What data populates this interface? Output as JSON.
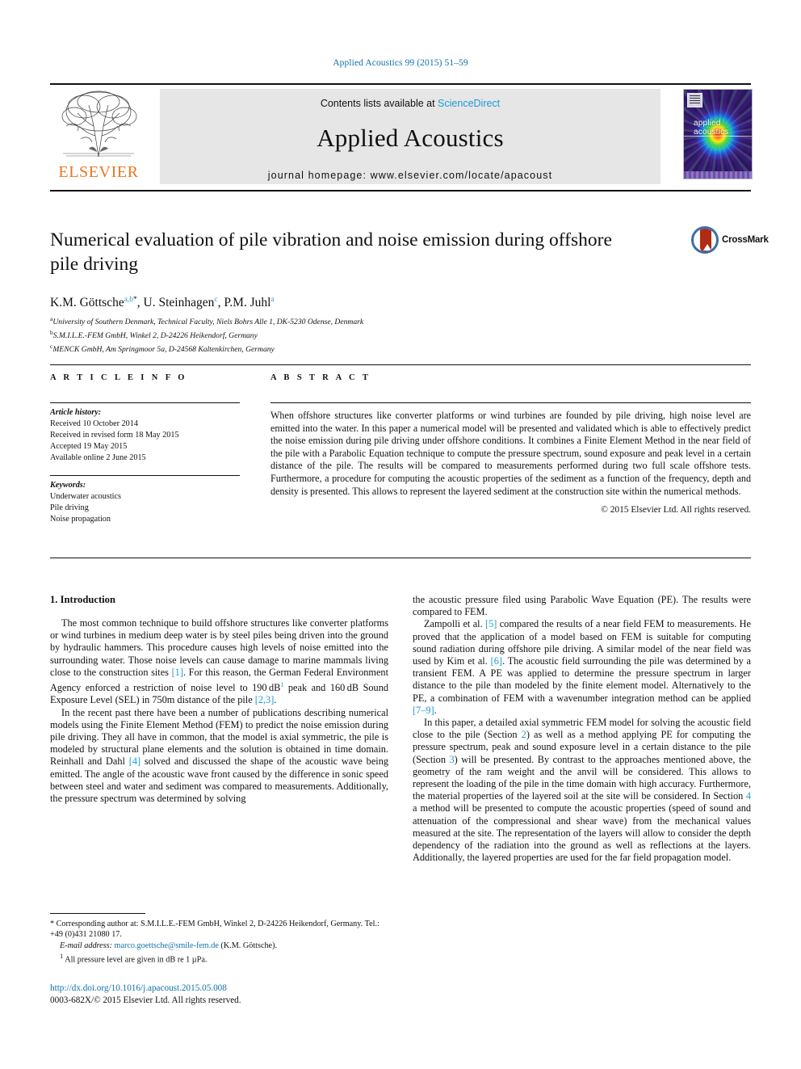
{
  "running_head": "Applied Acoustics 99 (2015) 51–59",
  "masthead": {
    "contents_prefix": "Contents lists available at ",
    "sciencedirect": "ScienceDirect",
    "journal_title": "Applied Acoustics",
    "homepage": "journal homepage: www.elsevier.com/locate/apacoust",
    "publisher_name": "ELSEVIER",
    "cover_label_line1": "applied",
    "cover_label_line2": "acoustics"
  },
  "article": {
    "title": "Numerical evaluation of pile vibration and noise emission during offshore pile driving",
    "crossmark_label": "CrossMark",
    "authors_html": "K.M. Göttsche<sup>a,b</sup><sup class=\"ast\">*</sup>, U. Steinhagen<sup>c</sup>, P.M. Juhl<sup>a</sup>",
    "affiliations": [
      "University of Southern Denmark, Technical Faculty, Niels Bohrs Alle 1, DK-5230 Odense, Denmark",
      "S.M.I.L.E.-FEM GmbH, Winkel 2, D-24226 Heikendorf, Germany",
      "MENCK GmbH, Am Springmoor 5a, D-24568 Kaltenkirchen, Germany"
    ],
    "affiliation_marks": [
      "a",
      "b",
      "c"
    ]
  },
  "headers": {
    "article_info": "A R T I C L E   I N F O",
    "abstract": "A B S T R A C T"
  },
  "article_info": {
    "history_head": "Article history:",
    "history": [
      "Received 10 October 2014",
      "Received in revised form 18 May 2015",
      "Accepted 19 May 2015",
      "Available online 2 June 2015"
    ],
    "keywords_head": "Keywords:",
    "keywords": [
      "Underwater acoustics",
      "Pile driving",
      "Noise propagation"
    ]
  },
  "abstract": {
    "text": "When offshore structures like converter platforms or wind turbines are founded by pile driving, high noise level are emitted into the water. In this paper a numerical model will be presented and validated which is able to effectively predict the noise emission during pile driving under offshore conditions. It combines a Finite Element Method in the near field of the pile with a Parabolic Equation technique to compute the pressure spectrum, sound exposure and peak level in a certain distance of the pile. The results will be compared to measurements performed during two full scale offshore tests. Furthermore, a procedure for computing the acoustic properties of the sediment as a function of the frequency, depth and density is presented. This allows to represent the layered sediment at the construction site within the numerical methods.",
    "copyright": "© 2015 Elsevier Ltd. All rights reserved."
  },
  "body": {
    "section_heading": "1. Introduction",
    "left_paragraphs": [
      "The most common technique to build offshore structures like converter platforms or wind turbines in medium deep water is by steel piles being driven into the ground by hydraulic hammers. This procedure causes high levels of noise emitted into the surrounding water. Those noise levels can cause damage to marine mammals living close to the construction sites [1]. For this reason, the German Federal Environment Agency enforced a restriction of noise level to 190 dB1 peak and 160 dB Sound Exposure Level (SEL) in 750m distance of the pile [2,3].",
      "In the recent past there have been a number of publications describing numerical models using the Finite Element Method (FEM) to predict the noise emission during pile driving. They all have in common, that the model is axial symmetric, the pile is modeled by structural plane elements and the solution is obtained in time domain. Reinhall and Dahl [4] solved and discussed the shape of the acoustic wave being emitted. The angle of the acoustic wave front caused by the difference in sonic speed between steel and water and sediment was compared to measurements. Additionally, the pressure spectrum was determined by solving"
    ],
    "right_paragraphs": [
      "the acoustic pressure filed using Parabolic Wave Equation (PE). The results were compared to FEM.",
      "Zampolli et al. [5] compared the results of a near field FEM to measurements. He proved that the application of a model based on FEM is suitable for computing sound radiation during offshore pile driving. A similar model of the near field was used by Kim et al. [6]. The acoustic field surrounding the pile was determined by a transient FEM. A PE was applied to determine the pressure spectrum in larger distance to the pile than modeled by the finite element model. Alternatively to the PE, a combination of FEM with a wavenumber integration method can be applied [7–9].",
      "In this paper, a detailed axial symmetric FEM model for solving the acoustic field close to the pile (Section 2) as well as a method applying PE for computing the pressure spectrum, peak and sound exposure level in a certain distance to the pile (Section 3) will be presented. By contrast to the approaches mentioned above, the geometry of the ram weight and the anvil will be considered. This allows to represent the loading of the pile in the time domain with high accuracy. Furthermore, the material properties of the layered soil at the site will be considered. In Section 4 a method will be presented to compute the acoustic properties (speed of sound and attenuation of the compressional and shear wave) from the mechanical values measured at the site. The representation of the layers will allow to consider the depth dependency of the radiation into the ground as well as reflections at the layers. Additionally, the layered properties are used for the far field propagation model."
    ]
  },
  "footnotes": {
    "corresponding": "* Corresponding author at: S.M.I.L.E.-FEM GmbH, Winkel 2, D-24226 Heikendorf, Germany. Tel.: +49 (0)431 21080 17.",
    "email_label": "E-mail address:",
    "email": "marco.goettsche@smile-fem.de",
    "email_owner": "(K.M. Göttsche).",
    "footnote1_marker": "1",
    "footnote1": "All pressure level are given in dB re 1 µPa."
  },
  "doi_block": {
    "doi": "http://dx.doi.org/10.1016/j.apacoust.2015.05.008",
    "issn": "0003-682X/© 2015 Elsevier Ltd. All rights reserved."
  },
  "colors": {
    "link_blue": "#1171a8",
    "ref_blue": "#1c9ad6",
    "elsevier_orange": "#E87722",
    "band_gray": "#e6e6e6"
  }
}
